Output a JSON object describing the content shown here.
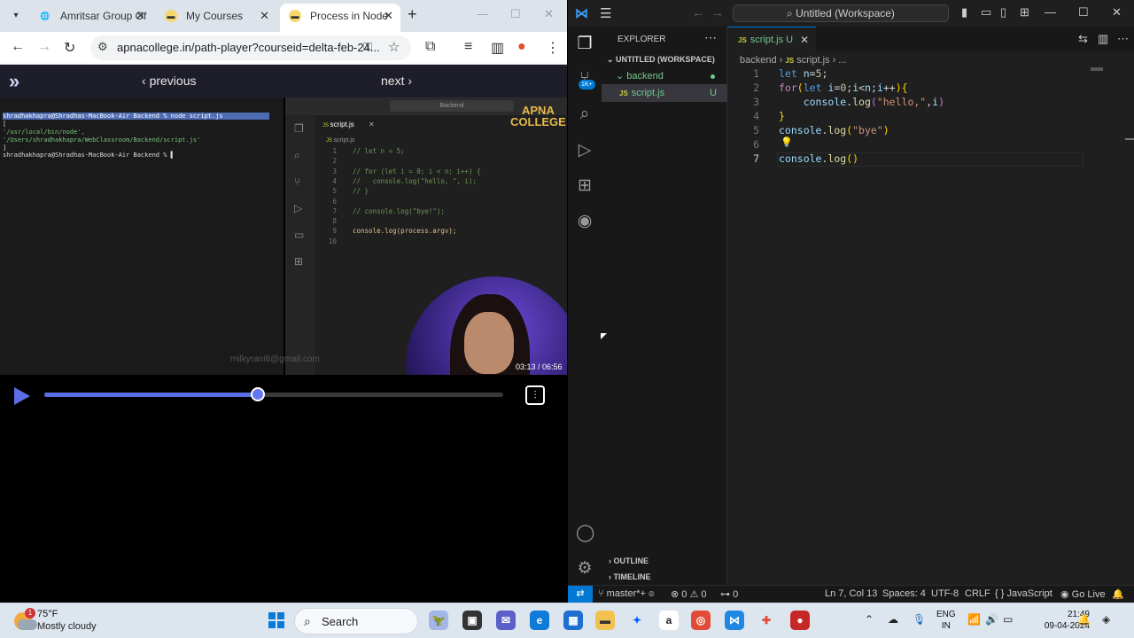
{
  "browser": {
    "tabs": [
      {
        "title": "Amritsar Group Of",
        "icon": "globe-icon"
      },
      {
        "title": "My Courses",
        "icon": "course-icon"
      },
      {
        "title": "Process in Node",
        "icon": "course-icon",
        "active": true
      }
    ],
    "url": "apnacollege.in/path-player?courseid=delta-feb-24...",
    "page": {
      "previous_label": "previous",
      "next_label": "next",
      "expand_icon": "double-chevron-right-icon"
    },
    "video": {
      "terminal": {
        "prompt_line": "shradhakhapra@Shradhas-MacBook-Air Backend % node script.js",
        "output_lines": [
          "[",
          "  '/usr/local/bin/node',",
          "  '/Users/shradhakhapra/WebClassroom/Backend/script.js'",
          "]"
        ],
        "last_prompt": "shradhakhapra@Shradhas-MacBook-Air Backend % "
      },
      "editor": {
        "search_label": "Backend",
        "tab_label": "script.js",
        "breadcrumb": "script.js",
        "lines": [
          "// let n = 5;",
          "",
          "// for (let i = 0; i < n; i++) {",
          "//   console.log(\"hello, \", i);",
          "// }",
          "",
          "// console.log(\"bye!\");",
          "",
          "console.log(process.argv);",
          ""
        ]
      },
      "logo_line1": "APNA",
      "logo_line2": "COLLEGE",
      "watermark": "milkyrani8@gmail.com",
      "timecode": "03:13 / 06:56",
      "progress": 0.465
    }
  },
  "vscode": {
    "title": "Untitled (Workspace)",
    "explorer": {
      "header": "EXPLORER",
      "workspace": "UNTITLED (WORKSPACE)",
      "folder": "backend",
      "file": "script.js",
      "file_status": "U",
      "outline": "OUTLINE",
      "timeline": "TIMELINE",
      "badge": "1K+"
    },
    "editor": {
      "tab_label": "script.js",
      "tab_status": "U",
      "breadcrumb_folder": "backend",
      "breadcrumb_file": "script.js",
      "breadcrumb_more": "...",
      "current_line": 7
    },
    "status": {
      "branch": "master*+",
      "errors": "0",
      "warnings": "0",
      "ports": "0",
      "position": "Ln 7, Col 13",
      "spaces": "Spaces: 4",
      "encoding": "UTF-8",
      "eol": "CRLF",
      "language": "JavaScript",
      "golive": "Go Live"
    }
  },
  "taskbar": {
    "temperature": "75°F",
    "weather": "Mostly cloudy",
    "weather_badge": "1",
    "search_label": "Search",
    "lang1": "ENG",
    "lang2": "IN",
    "time": "21:49",
    "date": "09-04-2024"
  },
  "colors": {
    "accent": "#0078d4",
    "player_accent": "#5a6ee6",
    "git_untracked": "#73c991"
  }
}
